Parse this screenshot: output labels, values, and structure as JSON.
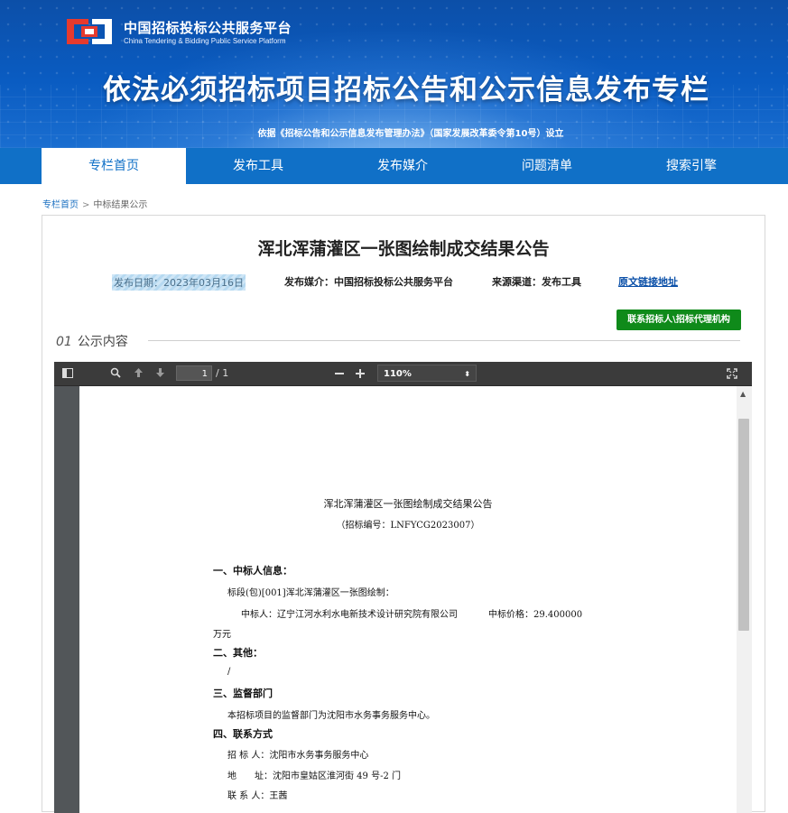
{
  "header": {
    "brand_cn": "中国招标投标公共服务平台",
    "brand_en": "China Tendering & Bidding Public Service Platform",
    "title": "依法必须招标项目招标公告和公示信息发布专栏",
    "subtitle": "依据《招标公告和公示信息发布管理办法》（国家发展改革委令第10号）设立"
  },
  "nav": {
    "items": [
      {
        "label": "专栏首页"
      },
      {
        "label": "发布工具"
      },
      {
        "label": "发布媒介"
      },
      {
        "label": "问题清单"
      },
      {
        "label": "搜索引擎"
      }
    ]
  },
  "breadcrumb": {
    "home": "专栏首页",
    "separator": ">",
    "current": "中标结果公示"
  },
  "article": {
    "title": "浑北浑蒲灌区一张图绘制成交结果公告",
    "publish_date": "发布日期：2023年03月16日",
    "media": "发布媒介：中国招标投标公共服务平台",
    "channel": "来源渠道：发布工具",
    "source_link": "原文链接地址",
    "contact_button": "联系招标人\\招标代理机构",
    "section_num": "01",
    "section_label": "公示内容"
  },
  "viewer": {
    "page_current": "1",
    "page_total": "/ 1",
    "zoom": "110%",
    "zoom_caret": "⬍"
  },
  "pdf": {
    "title": "浑北浑蒲灌区一张图绘制成交结果公告",
    "code": "（招标编号：LNFYCG2023007）",
    "s1": "一、中标人信息：",
    "s1_lot": "标段(包)[001]浑北浑蒲灌区一张图绘制：",
    "s1_winner": "中标人：辽宁江河水利水电新技术设计研究院有限公司",
    "s1_price": "中标价格：29.400000",
    "s1_unit": "万元",
    "s2": "二、其他：",
    "s2_text": "/",
    "s3": "三、监督部门",
    "s3_text": "本招标项目的监督部门为沈阳市水务事务服务中心。",
    "s4": "四、联系方式",
    "s4_tenderer": "招 标 人：沈阳市水务事务服务中心",
    "s4_address": "地　　址：沈阳市皇姑区淮河街 49 号-2 门",
    "s4_contact": "联 系 人：王茜"
  },
  "colors": {
    "nav_bg": "#1070c7",
    "contact_button": "#0f8a1a",
    "link": "#0b50a8"
  }
}
